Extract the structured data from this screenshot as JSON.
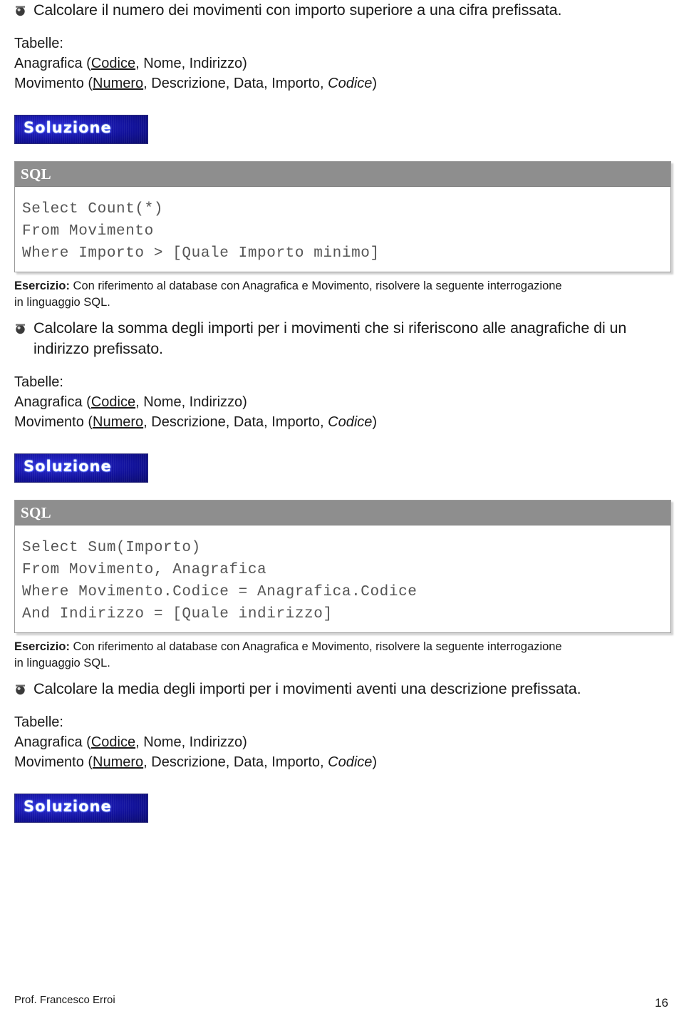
{
  "document": {
    "footer_author": "Prof. Francesco Erroi",
    "page_number": "16"
  },
  "labels": {
    "tabelle": "Tabelle:",
    "sql_panel_title": "SQL",
    "soluzione_button": "Soluzione"
  },
  "tables": {
    "anagrafica_prefix": "Anagrafica (",
    "anagrafica_key": "Codice",
    "anagrafica_rest": ", Nome, Indirizzo)",
    "movimento_prefix": "Movimento (",
    "movimento_key": "Numero",
    "movimento_mid": ", Descrizione, Data, Importo, ",
    "movimento_italic": "Codice",
    "movimento_suffix": ")"
  },
  "exercises": [
    {
      "question": "Calcolare il numero dei movimenti con importo superiore a una cifra prefissata.",
      "sql": "Select Count(*)\nFrom Movimento\nWhere Importo > [Quale Importo minimo]"
    },
    {
      "question": "Calcolare la somma degli importi per i movimenti che si riferiscono alle anagrafiche di un indirizzo prefissato.",
      "sql": "Select Sum(Importo)\nFrom Movimento, Anagrafica\nWhere Movimento.Codice = Anagrafica.Codice\nAnd Indirizzo = [Quale indirizzo]"
    },
    {
      "question": "Calcolare la media degli importi per i movimenti aventi una descrizione prefissata.",
      "sql": ""
    }
  ],
  "esercizio_intro": {
    "bold": "Esercizio:",
    "text_line1": " Con riferimento al database con Anagrafica e Movimento, risolvere la seguente interrogazione",
    "text_line2": "in linguaggio SQL."
  }
}
